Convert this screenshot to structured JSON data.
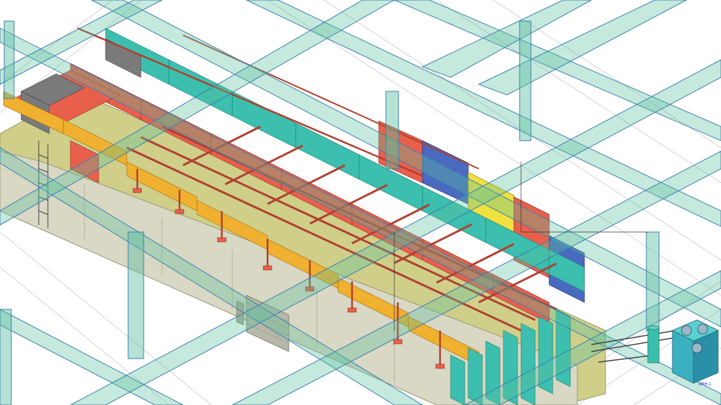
{
  "view": {
    "type": "isometric-3d-bim-model",
    "background": "#ffffff"
  },
  "palette": {
    "steel_frame": "#5cbf9f",
    "steel_edge": "#3a7fb0",
    "floor": "#cfcf8a",
    "wall": "#d8d8c0",
    "red_duct": "#e8604c",
    "teal_duct": "#3cbfae",
    "orange_duct": "#f0b030",
    "pipe_rack": "#b04030",
    "blue_panel": "#4a6ac0",
    "yellow_panel": "#f0e040",
    "magenta": "#a040c0",
    "machine_gray": "#707070"
  },
  "annotations": {
    "equipment_tag": "ARH-1"
  }
}
